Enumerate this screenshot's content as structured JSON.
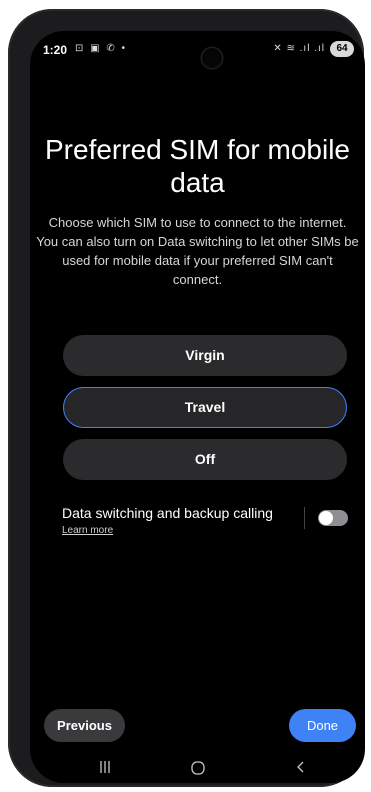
{
  "status_bar": {
    "time": "1:20",
    "left_icons": "⊡ ▣ ✆ •",
    "right_icons": "✕ ≋ .ıl .ıl",
    "battery": "64"
  },
  "screen": {
    "title": "Preferred SIM for mobile data",
    "description": "Choose which SIM to use to connect to the internet. You can also turn on Data switching to let other SIMs be used for mobile data if your preferred SIM can't connect."
  },
  "sim_options": [
    {
      "label": "Virgin",
      "selected": false
    },
    {
      "label": "Travel",
      "selected": true
    },
    {
      "label": "Off",
      "selected": false
    }
  ],
  "data_switching": {
    "label": "Data switching and backup calling",
    "link": "Learn more",
    "enabled": false
  },
  "footer": {
    "previous_label": "Previous",
    "done_label": "Done"
  },
  "nav": {
    "recents_icon": "recents-icon",
    "home_icon": "home-icon",
    "back_icon": "back-icon"
  },
  "colors": {
    "accent": "#3e82f6",
    "button_bg": "#2b2b2d",
    "screen_bg": "#000000"
  }
}
